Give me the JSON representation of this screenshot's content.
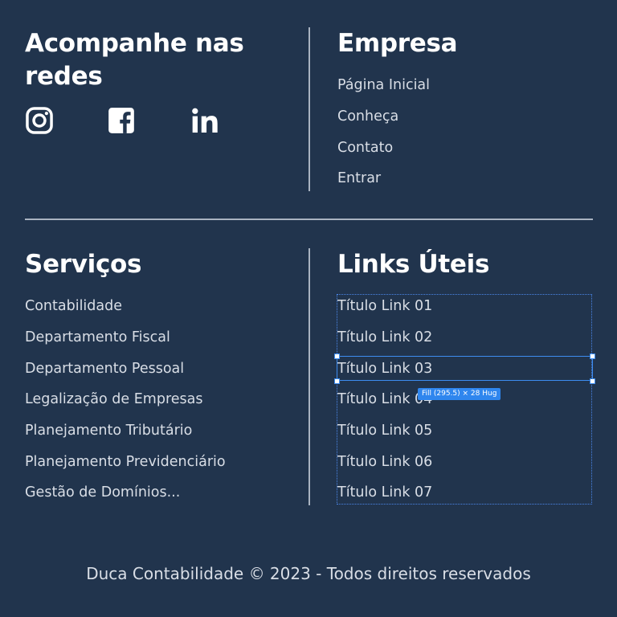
{
  "social": {
    "heading": "Acompanhe nas redes",
    "icons": [
      "instagram-icon",
      "facebook-icon",
      "linkedin-icon"
    ]
  },
  "empresa": {
    "heading": "Empresa",
    "links": [
      "Página Inicial",
      "Conheça",
      "Contato",
      "Entrar"
    ]
  },
  "servicos": {
    "heading": "Serviços",
    "links": [
      "Contabilidade",
      "Departamento Fiscal",
      "Departamento Pessoal",
      "Legalização de Empresas",
      "Planejamento Tributário",
      "Planejamento Previdenciário",
      "Gestão de Domínios..."
    ]
  },
  "links_uteis": {
    "heading": "Links Úteis",
    "links": [
      "Título Link 01",
      "Título Link 02",
      "Título Link 03",
      "Título Link 04",
      "Título Link 05",
      "Título Link 06",
      "Título Link 07"
    ]
  },
  "selection": {
    "size_label": "Fill (295.5) × 28 Hug"
  },
  "footer": {
    "text": "Duca Contabilidade © 2023 - Todos direitos reservados"
  },
  "colors": {
    "background": "#21344d",
    "divider": "#a9b3c1",
    "selection": "#3d8cf0"
  }
}
